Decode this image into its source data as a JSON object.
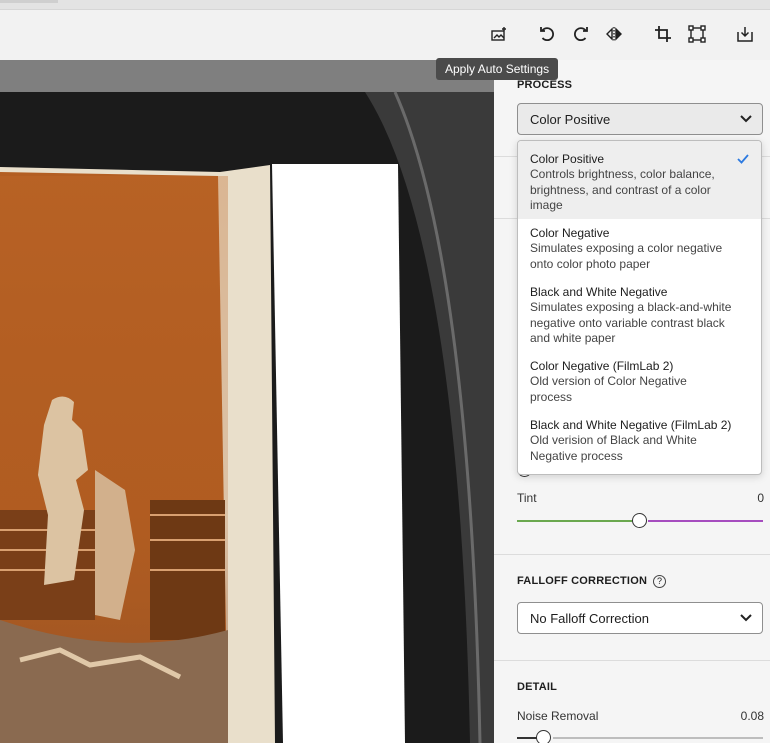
{
  "toolbar": {
    "icons": [
      "apply-auto-settings-icon",
      "rotate-left-icon",
      "rotate-right-icon",
      "flip-horizontal-icon",
      "crop-icon",
      "transform-icon",
      "export-icon"
    ]
  },
  "tooltip": {
    "text": "Apply Auto Settings"
  },
  "panel": {
    "process": {
      "title": "PROCESS",
      "selected": "Color Positive"
    },
    "dropdown": {
      "options": [
        {
          "title": "Color Positive",
          "description": "Controls brightness, color balance, brightness, and contrast of a color image",
          "selected": true
        },
        {
          "title": "Color Negative",
          "description": "Simulates exposing a color negative onto color photo paper"
        },
        {
          "title": "Black and White Negative",
          "description": "Simulates exposing a black-and-white negative onto variable contrast black and white paper"
        },
        {
          "title": "Color Negative (FilmLab 2)",
          "description": "Old version of Color Negative process"
        },
        {
          "title": "Black and White Negative (FilmLab 2)",
          "description": "Old verision of Black and White Negative process"
        }
      ]
    },
    "tint": {
      "label": "Tint",
      "value": "0",
      "level": 0.5
    },
    "falloff": {
      "title": "FALLOFF CORRECTION",
      "help": "?",
      "selected": "No Falloff Correction"
    },
    "detail": {
      "title": "DETAIL",
      "noise": {
        "label": "Noise Removal",
        "value": "0.08",
        "level": 0.08
      }
    }
  },
  "colors": {
    "accent": "#2d7ae0",
    "tint_left": "#6aa84f",
    "tint_right": "#a64dbf",
    "viewer_bg": "#1e1e1e",
    "negative_orange": "#b5601f"
  }
}
